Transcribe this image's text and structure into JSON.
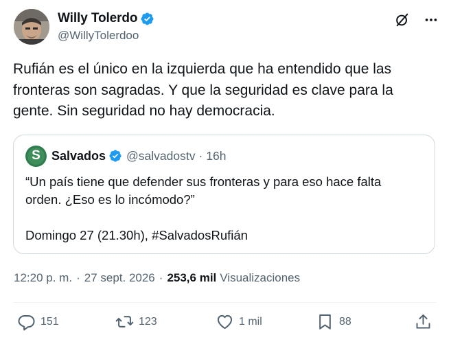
{
  "author": {
    "name": "Willy Tolerdo",
    "handle": "@WillyTolerdoo",
    "verified": true
  },
  "tweet": {
    "text": "Rufián es el único en la izquierda que ha entendido que las\nfronteras son sagradas. Y que la seguridad es clave para la\ngente. Sin seguridad no hay democracia."
  },
  "quote": {
    "avatar_letter": "S",
    "name": "Salvados",
    "handle": "@salvadostv",
    "dot": "·",
    "time": "16h",
    "text": "“Un país tiene que defender sus fronteras y para eso hace falta\norden. ¿Eso es lo incómodo?”\n\nDomingo 27 (21.30h), #SalvadosRufián"
  },
  "meta": {
    "time": "12:20 p. m.",
    "sep1": "·",
    "date": "27 sept. 2026",
    "sep2": "·",
    "views_count": "253,6 mil",
    "views_label": "Visualizaciones"
  },
  "actions": {
    "replies": "151",
    "reposts": "123",
    "likes": "1 mil",
    "bookmarks": "88"
  },
  "colors": {
    "verified_blue": "#1d9bf0",
    "secondary_text": "#536471",
    "border": "#cfd9de"
  }
}
